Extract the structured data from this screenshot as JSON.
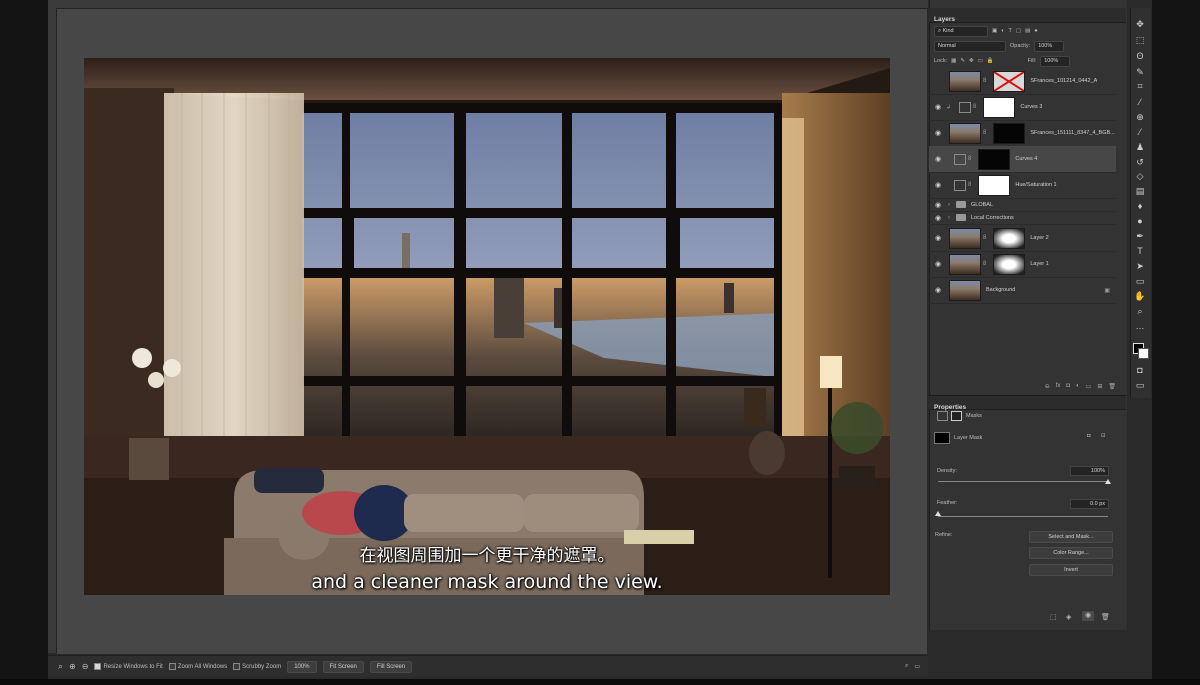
{
  "subtitles": {
    "chinese": "在视图周围加一个更干净的遮罩。",
    "english": "and a cleaner mask around the view."
  },
  "layers_panel": {
    "title": "Layers",
    "filter_kind": "Kind",
    "blend_mode": "Normal",
    "opacity_label": "Opacity:",
    "opacity_value": "100%",
    "lock_label": "Lock:",
    "fill_label": "Fill:",
    "fill_value": "100%",
    "layers": [
      {
        "name": "SFrances_101214_0442_A",
        "visible": false,
        "thumb": "photo",
        "mask": "cross"
      },
      {
        "name": "Curves 3",
        "visible": true,
        "thumb": "curves",
        "mask": "white"
      },
      {
        "name": "SFrances_151111_8347_4_BGB...",
        "visible": true,
        "thumb": "photo",
        "mask": "black"
      },
      {
        "name": "Curves 4",
        "visible": true,
        "thumb": "curves",
        "mask": "black",
        "selected": true
      },
      {
        "name": "Hue/Saturation 1",
        "visible": true,
        "thumb": "huesat",
        "mask": "white"
      },
      {
        "name": "GLOBAL",
        "visible": true,
        "type": "group"
      },
      {
        "name": "Local Corrections",
        "visible": true,
        "type": "group"
      },
      {
        "name": "Layer 2",
        "visible": true,
        "thumb": "photo",
        "mask": "maskw"
      },
      {
        "name": "Layer 1",
        "visible": true,
        "thumb": "photo",
        "mask": "maskw"
      },
      {
        "name": "Background",
        "visible": true,
        "thumb": "photo",
        "locked": true
      }
    ]
  },
  "properties_panel": {
    "title": "Properties",
    "masks_label": "Masks",
    "layer_mask_label": "Layer Mask",
    "density_label": "Density:",
    "density_value": "100%",
    "density_fraction": 1.0,
    "feather_label": "Feather:",
    "feather_value": "0.0 px",
    "feather_fraction": 0.0,
    "refine_label": "Refine:",
    "buttons": [
      "Select and Mask...",
      "Color Range...",
      "Invert"
    ]
  },
  "options_bar": {
    "resize_windows_label": "Resize Windows to Fit",
    "resize_checked": true,
    "zoom_all_label": "Zoom All Windows",
    "zoom_all_checked": false,
    "scrubby_label": "Scrubby Zoom",
    "scrubby_checked": false,
    "zoom_value": "100%",
    "fit_screen_1": "Fit Screen",
    "fill_screen": "Fill Screen"
  },
  "tools": [
    "move-icon",
    "marquee-icon",
    "lasso-icon",
    "quick-select-icon",
    "crop-icon",
    "eyedropper-icon",
    "healing-icon",
    "brush-icon",
    "stamp-icon",
    "history-brush-icon",
    "eraser-icon",
    "gradient-icon",
    "blur-icon",
    "dodge-icon",
    "pen-icon",
    "type-icon",
    "path-select-icon",
    "shape-icon",
    "hand-icon",
    "zoom-icon",
    "more-icon"
  ]
}
